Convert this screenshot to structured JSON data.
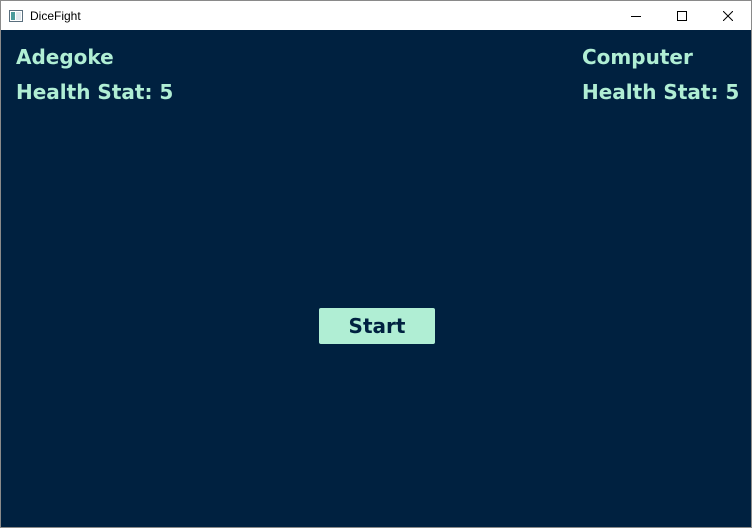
{
  "window": {
    "title": "DiceFight",
    "icons": {
      "app": "app-window-icon",
      "minimize": "minimize-icon",
      "maximize": "maximize-icon",
      "close": "close-icon"
    }
  },
  "player": {
    "name": "Adegoke",
    "health_label": "Health Stat: 5"
  },
  "opponent": {
    "name": "Computer",
    "health_label": "Health Stat: 5"
  },
  "actions": {
    "start_label": "Start"
  },
  "colors": {
    "background": "#002140",
    "accent": "#b0eed4",
    "button_text": "#002140"
  }
}
